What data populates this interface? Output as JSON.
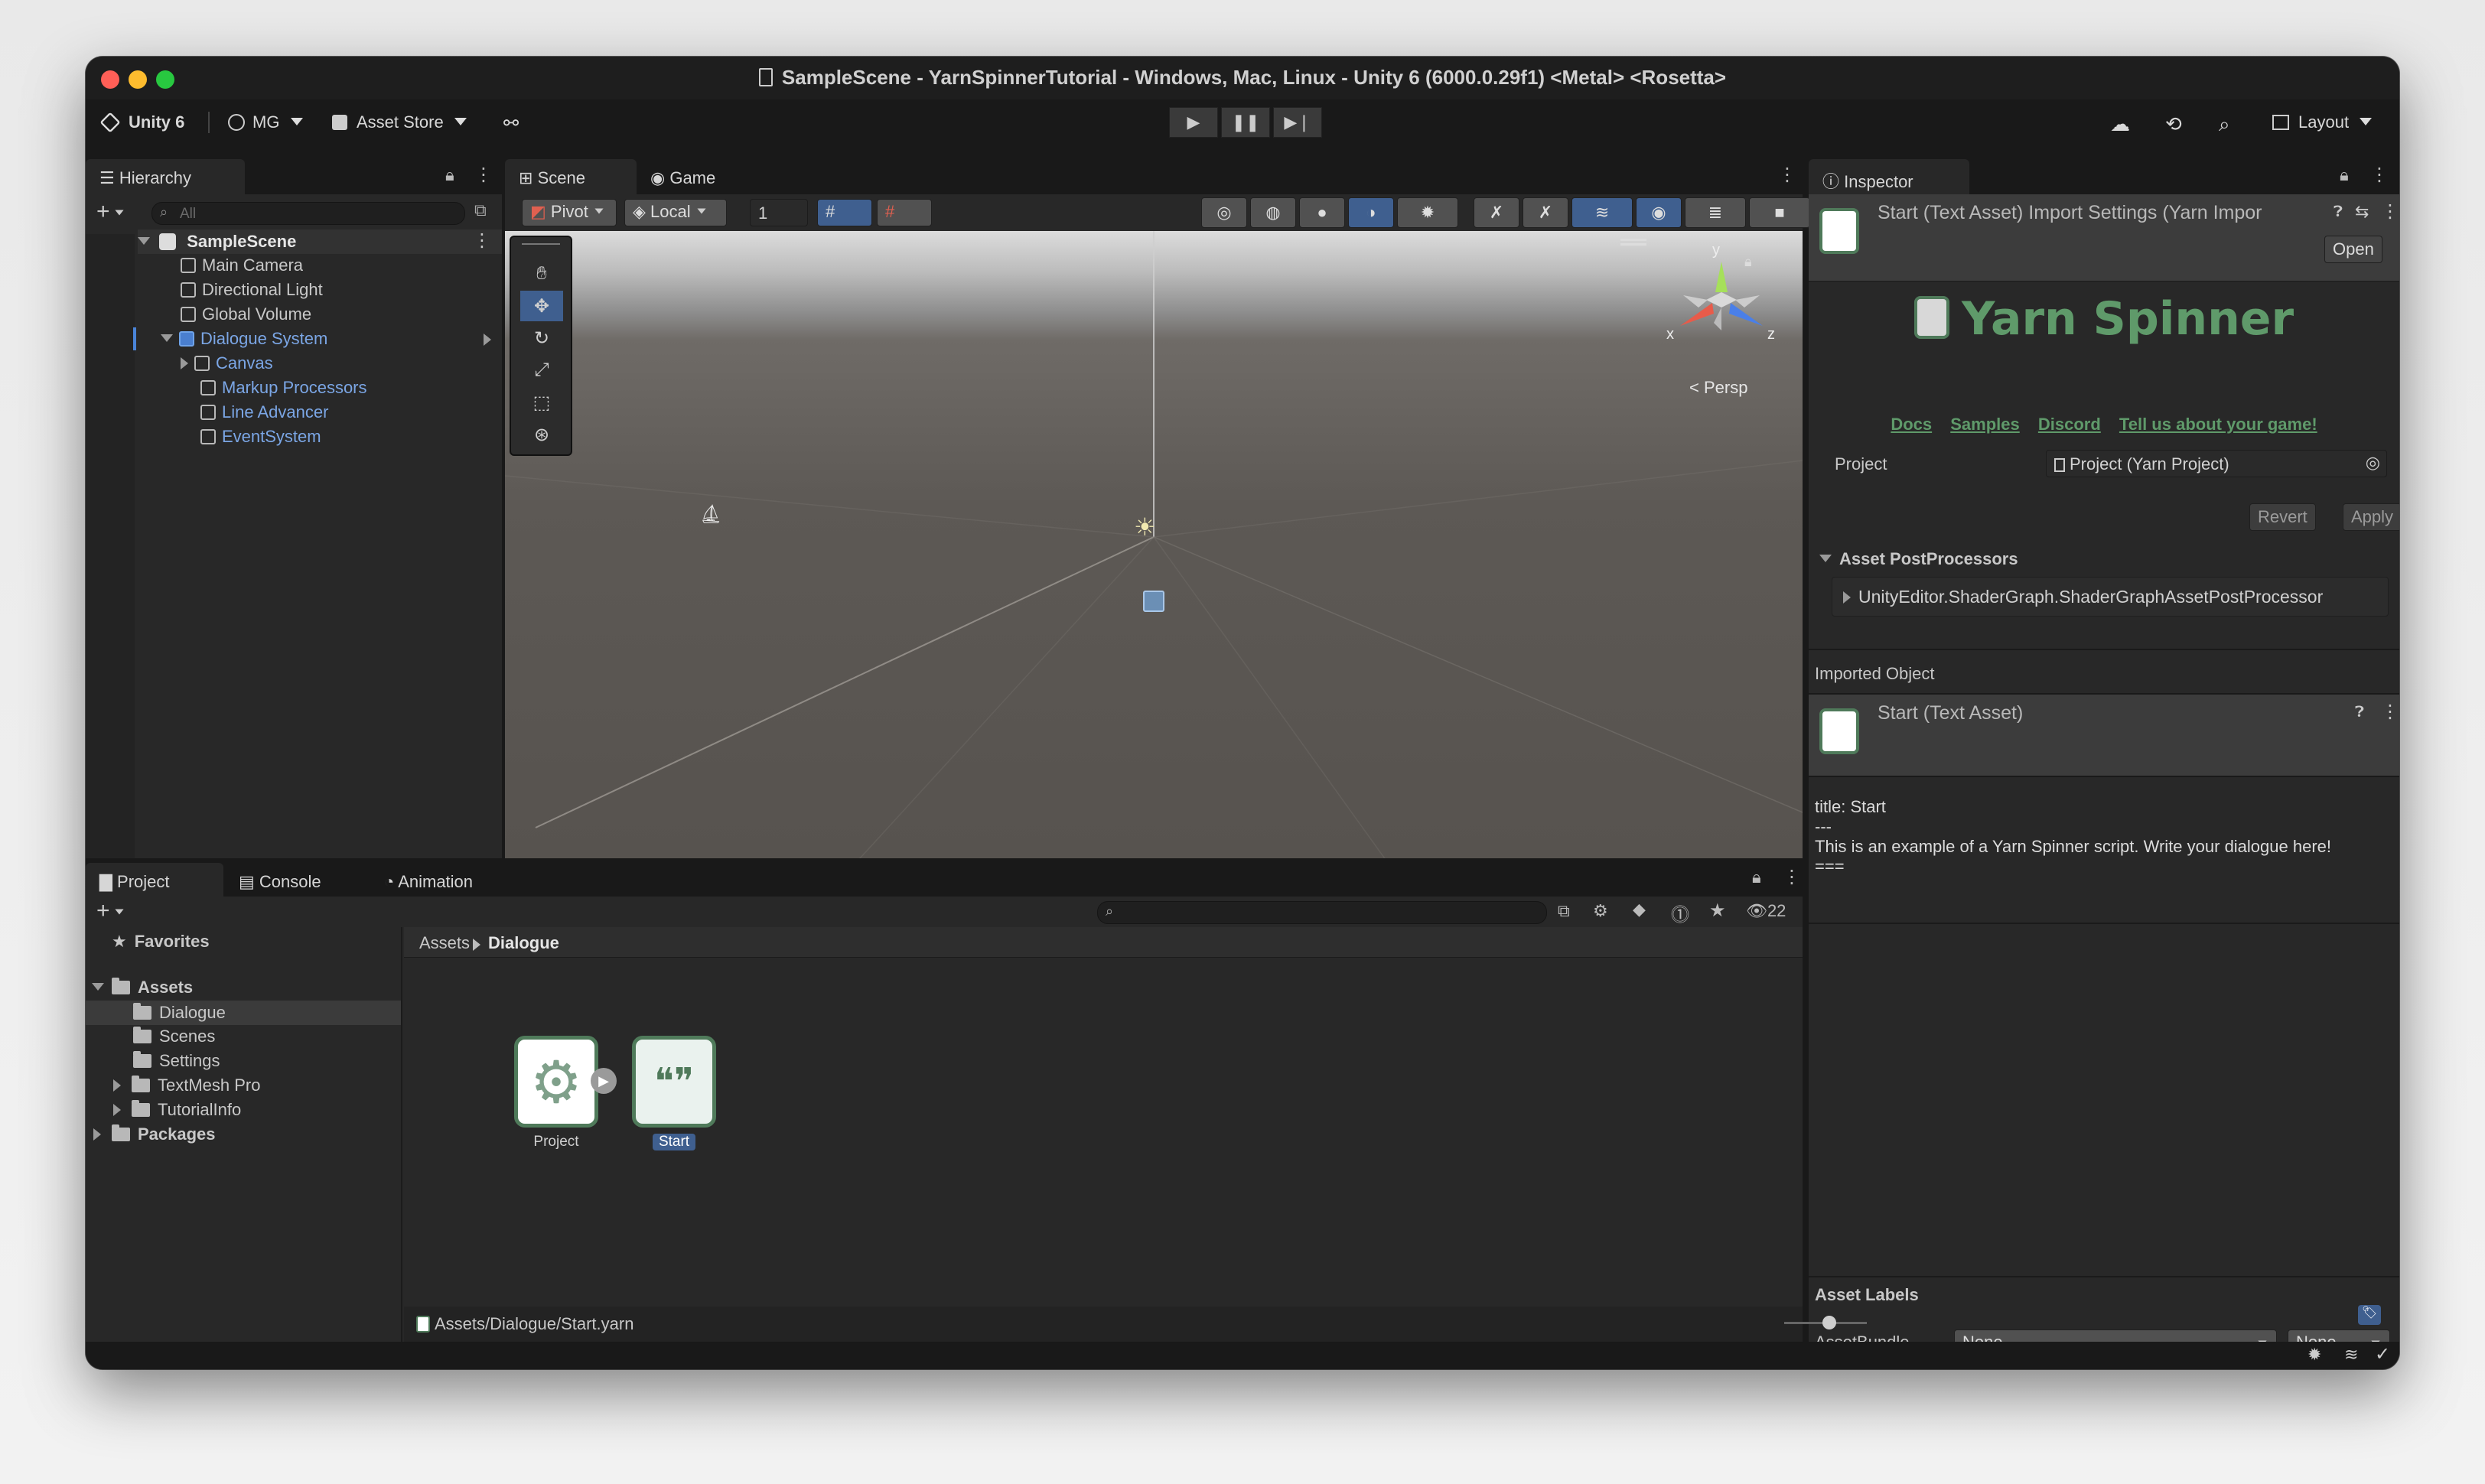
{
  "window": {
    "title": "SampleScene - YarnSpinnerTutorial - Windows, Mac, Linux - Unity 6 (6000.0.29f1) <Metal> <Rosetta>"
  },
  "toolbar": {
    "unity_label": "Unity 6",
    "account_label": "MG",
    "asset_store_label": "Asset Store",
    "layout_label": "Layout"
  },
  "hierarchy": {
    "tab": "Hierarchy",
    "search_placeholder": "All",
    "scene": "SampleScene",
    "items": [
      {
        "label": "Main Camera"
      },
      {
        "label": "Directional Light"
      },
      {
        "label": "Global Volume"
      },
      {
        "label": "Dialogue System"
      },
      {
        "label": "Canvas"
      },
      {
        "label": "Markup Processors"
      },
      {
        "label": "Line Advancer"
      },
      {
        "label": "EventSystem"
      }
    ]
  },
  "scene": {
    "tab_scene": "Scene",
    "tab_game": "Game",
    "pivot_label": "Pivot",
    "local_label": "Local",
    "grid_value": "1",
    "persp_label": "Persp",
    "axis_x": "x",
    "axis_y": "y",
    "axis_z": "z"
  },
  "project": {
    "tab_project": "Project",
    "tab_console": "Console",
    "tab_animation": "Animation",
    "favorites": "Favorites",
    "assets": "Assets",
    "folders": [
      "Dialogue",
      "Scenes",
      "Settings",
      "TextMesh Pro",
      "TutorialInfo"
    ],
    "packages": "Packages",
    "breadcrumb_root": "Assets",
    "breadcrumb_current": "Dialogue",
    "hidden_count": "22",
    "asset_project": "Project",
    "asset_start": "Start",
    "status_path": "Assets/Dialogue/Start.yarn"
  },
  "inspector": {
    "tab": "Inspector",
    "header_title": "Start (Text Asset) Import Settings (Yarn Impor",
    "open_button": "Open",
    "brand": "Yarn Spinner",
    "links": [
      "Docs",
      "Samples",
      "Discord",
      "Tell us about your game!"
    ],
    "project_label": "Project",
    "project_value": "Project (Yarn Project)",
    "revert_button": "Revert",
    "apply_button": "Apply",
    "postprocessors_label": "Asset PostProcessors",
    "postprocessor_item": "UnityEditor.ShaderGraph.ShaderGraphAssetPostProcessor",
    "imported_object_label": "Imported Object",
    "imported_object_title": "Start (Text Asset)",
    "script_lines": [
      "title: Start",
      "---",
      "This is an example of a Yarn Spinner script. Write your dialogue here!",
      "==="
    ],
    "asset_labels": "Asset Labels",
    "assetbundle_label": "AssetBundle",
    "assetbundle_value": "None",
    "assetbundle_variant": "None"
  }
}
